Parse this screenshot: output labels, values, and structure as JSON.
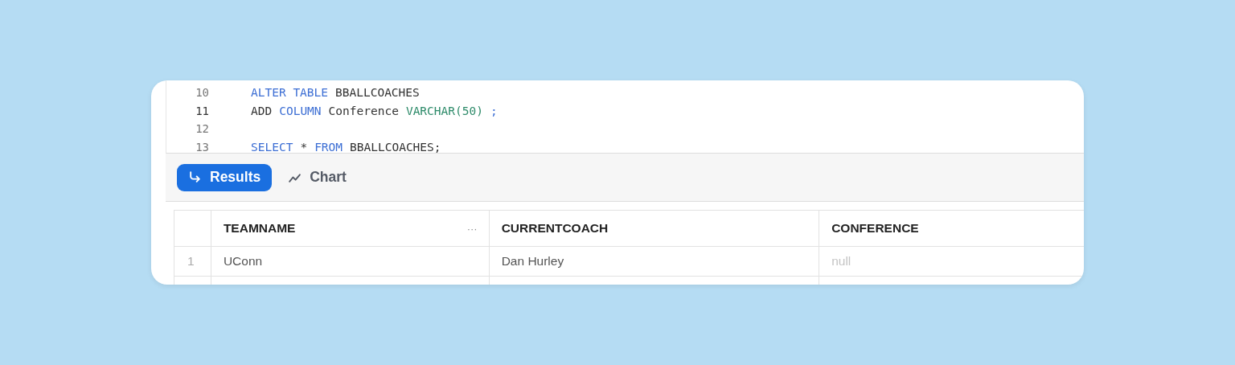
{
  "editor": {
    "lines": [
      {
        "number": "10",
        "current": false,
        "tokens": [
          {
            "kind": "keyword",
            "text": "ALTER TABLE"
          },
          {
            "kind": "plain",
            "text": "BBALLCOACHES"
          }
        ]
      },
      {
        "number": "11",
        "current": true,
        "tokens": [
          {
            "kind": "plain",
            "text": "ADD"
          },
          {
            "kind": "keyword",
            "text": "COLUMN"
          },
          {
            "kind": "plain",
            "text": "Conference"
          },
          {
            "kind": "type",
            "text": "VARCHAR(50)"
          },
          {
            "kind": "keyword",
            "text": ";"
          }
        ]
      },
      {
        "number": "12",
        "current": false
      },
      {
        "number": "13",
        "current": false,
        "tokens": [
          {
            "kind": "keyword",
            "text": "SELECT"
          },
          {
            "kind": "plain",
            "text": "*"
          },
          {
            "kind": "keyword",
            "text": "FROM"
          },
          {
            "kind": "plain",
            "text": "BBALLCOACHES;"
          }
        ]
      }
    ]
  },
  "tabs": [
    {
      "label": "Results",
      "kind": "return",
      "selected": true
    },
    {
      "label": "Chart",
      "kind": "chart",
      "selected": false
    }
  ],
  "table": {
    "columns": [
      {
        "label": "TEAMNAME",
        "menu": "···"
      },
      {
        "label": "CURRENTCOACH"
      },
      {
        "label": "CONFERENCE"
      }
    ],
    "rows": [
      {
        "number": "1",
        "cells": [
          {
            "text": "UConn",
            "is_null": false
          },
          {
            "text": "Dan Hurley",
            "is_null": false
          },
          {
            "text": "null",
            "is_null": true
          }
        ]
      }
    ]
  }
}
